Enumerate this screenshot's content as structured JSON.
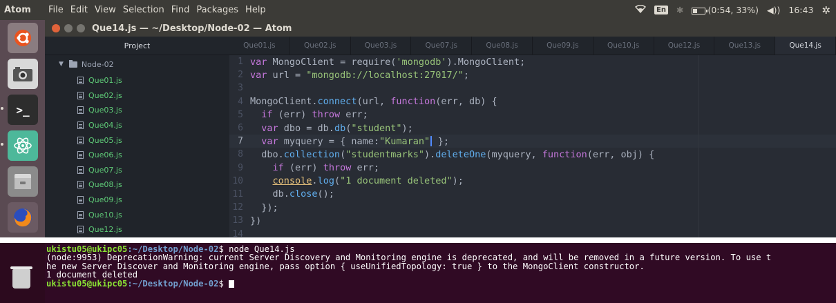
{
  "topbar": {
    "app_name": "Atom",
    "menu": [
      "File",
      "Edit",
      "View",
      "Selection",
      "Find",
      "Packages",
      "Help"
    ],
    "keyboard": "En",
    "battery": "(0:54, 33%)",
    "battery_level": 0.33,
    "time": "16:43"
  },
  "window": {
    "title": "Que14.js — ~/Desktop/Node-02 — Atom"
  },
  "tree": {
    "header": "Project",
    "root": "Node-02",
    "files": [
      "Que01.js",
      "Que02.js",
      "Que03.js",
      "Que04.js",
      "Que05.js",
      "Que06.js",
      "Que07.js",
      "Que08.js",
      "Que09.js",
      "Que10.js",
      "Que12.js"
    ]
  },
  "tabs": [
    "Que01.js",
    "Que02.js",
    "Que03.js",
    "Que07.js",
    "Que08.js",
    "Que09.js",
    "Que10.js",
    "Que12.js",
    "Que13.js",
    "Que14.js"
  ],
  "active_tab": "Que14.js",
  "editor": {
    "current_line": 7,
    "lines": [
      {
        "n": "1",
        "text": "var MongoClient = require('mongodb').MongoClient;"
      },
      {
        "n": "2",
        "text": "var url = \"mongodb://localhost:27017/\";"
      },
      {
        "n": "3",
        "text": ""
      },
      {
        "n": "4",
        "text": "MongoClient.connect(url, function(err, db) {"
      },
      {
        "n": "5",
        "text": "  if (err) throw err;"
      },
      {
        "n": "6",
        "text": "  var dbo = db.db(\"student\");"
      },
      {
        "n": "7",
        "text": "  var myquery = { name:\"Kumaran\" };"
      },
      {
        "n": "8",
        "text": "  dbo.collection(\"studentmarks\").deleteOne(myquery, function(err, obj) {"
      },
      {
        "n": "9",
        "text": "    if (err) throw err;"
      },
      {
        "n": "10",
        "text": "    console.log(\"1 document deleted\");"
      },
      {
        "n": "11",
        "text": "    db.close();"
      },
      {
        "n": "12",
        "text": "  });"
      },
      {
        "n": "13",
        "text": "})"
      },
      {
        "n": "14",
        "text": ""
      }
    ]
  },
  "terminal": {
    "prompt_user": "ukistu05@ukipc05",
    "prompt_path": ":~/Desktop/Node-02",
    "prompt_symbol": "$ ",
    "command": "node Que14.js",
    "output": [
      "(node:9953) DeprecationWarning: current Server Discovery and Monitoring engine is deprecated, and will be removed in a future version. To use t",
      "he new Server Discover and Monitoring engine, pass option { useUnifiedTopology: true } to the MongoClient constructor.",
      "1 document deleted"
    ]
  }
}
